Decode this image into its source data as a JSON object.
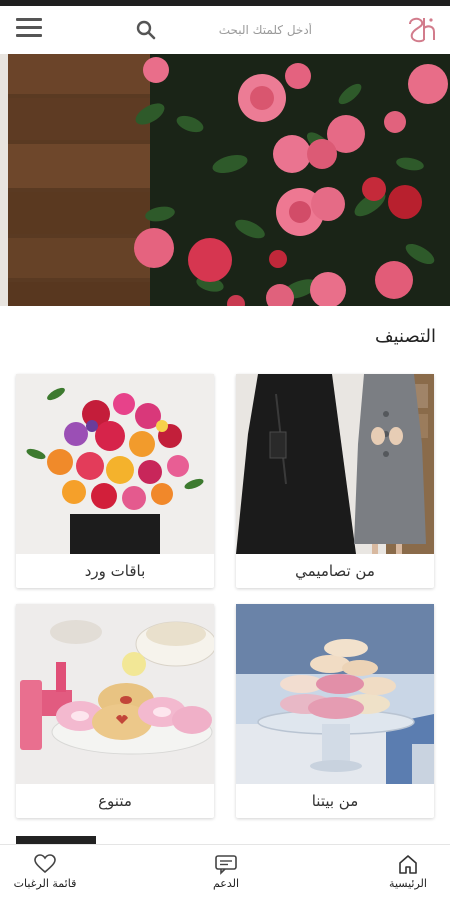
{
  "header": {
    "search_placeholder": "أدخل كلمتك البحث",
    "logo_text": "ح"
  },
  "hero": {
    "slide_count": 3,
    "active_slide": 3
  },
  "section": {
    "title": "التصنيف"
  },
  "categories": [
    {
      "label": "من تصاميمي"
    },
    {
      "label": "باقات ورد"
    },
    {
      "label": "من بيتنا"
    },
    {
      "label": "متنوع"
    }
  ],
  "bottom_nav": {
    "home": "الرئيسية",
    "support": "الدعم",
    "wishlist": "قائمة الرغبات"
  },
  "colors": {
    "accent": "#c98a97",
    "logo": "#d27c8c"
  }
}
